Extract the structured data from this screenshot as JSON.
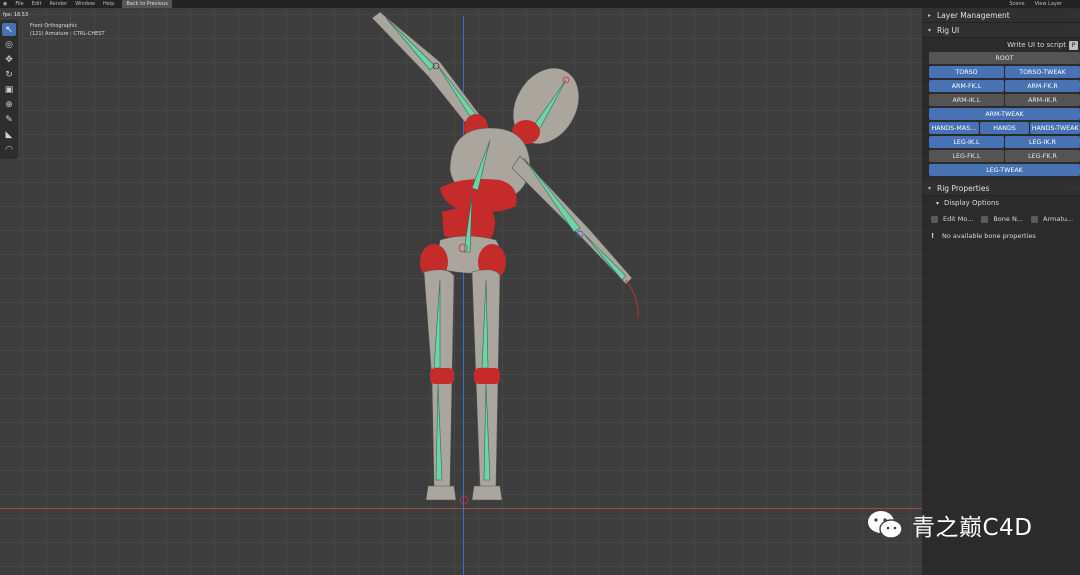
{
  "topbar": {
    "menu": [
      "File",
      "Edit",
      "Render",
      "Window",
      "Help"
    ],
    "back_button": "Back to Previous",
    "scene_label": "Scene",
    "view_layer_label": "View Layer"
  },
  "viewport": {
    "fps": "fps: 18.53",
    "view_name": "Front Orthographic",
    "object_info": "(121) Armature : CTRL-CHEST"
  },
  "toolbar": {
    "tools": [
      {
        "name": "select-tool-icon",
        "glyph": "↖",
        "active": true
      },
      {
        "name": "cursor-tool-icon",
        "glyph": "◎",
        "active": false
      },
      {
        "name": "move-tool-icon",
        "glyph": "✥",
        "active": false
      },
      {
        "name": "rotate-tool-icon",
        "glyph": "↻",
        "active": false
      },
      {
        "name": "scale-tool-icon",
        "glyph": "▣",
        "active": false
      },
      {
        "name": "transform-tool-icon",
        "glyph": "⊕",
        "active": false
      },
      {
        "name": "annotate-tool-icon",
        "glyph": "✎",
        "active": false
      },
      {
        "name": "measure-tool-icon",
        "glyph": "◣",
        "active": false
      },
      {
        "name": "roll-tool-icon",
        "glyph": "◠",
        "active": false
      }
    ]
  },
  "panel": {
    "layer_management": "Layer Management",
    "rig_ui": "Rig UI",
    "write_ui": "Write UI to script",
    "rig_rows": [
      [
        {
          "label": "ROOT",
          "on": false
        }
      ],
      [
        {
          "label": "TORSO",
          "on": true
        },
        {
          "label": "TORSO-TWEAK",
          "on": true
        }
      ],
      [
        {
          "label": "ARM-FK.L",
          "on": true
        },
        {
          "label": "ARM-FK.R",
          "on": true
        }
      ],
      [
        {
          "label": "ARM-IK.L",
          "on": false
        },
        {
          "label": "ARM-IK.R",
          "on": false
        }
      ],
      [
        {
          "label": "ARM-TWEAK",
          "on": true
        }
      ],
      [
        {
          "label": "HANDS-MAS...",
          "on": true
        },
        {
          "label": "HANDS",
          "on": true
        },
        {
          "label": "HANDS-TWEAK",
          "on": true
        }
      ],
      [
        {
          "label": "LEG-IK.L",
          "on": true
        },
        {
          "label": "LEG-IK.R",
          "on": true
        }
      ],
      [
        {
          "label": "LEG-FK.L",
          "on": false
        },
        {
          "label": "LEG-FK.R",
          "on": false
        }
      ],
      [
        {
          "label": "LEG-TWEAK",
          "on": true
        }
      ]
    ],
    "rig_properties": "Rig Properties",
    "display_options": "Display Options",
    "options": [
      "Edit Mo...",
      "Bone N...",
      "Armatu..."
    ],
    "no_props": "No available bone properties"
  },
  "watermark": {
    "text": "青之巅C4D"
  },
  "colors": {
    "accent": "#4772b3",
    "button_off": "#545454",
    "bone": "#6fd3a6",
    "body": "#a9a49c",
    "red_parts": "#c62b2b"
  }
}
